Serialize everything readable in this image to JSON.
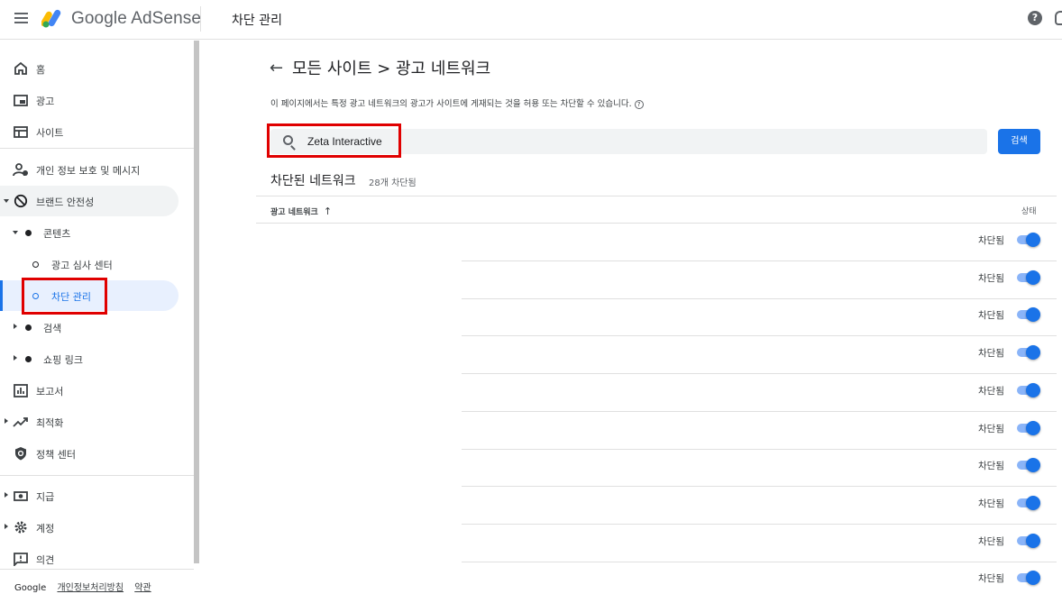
{
  "header": {
    "app_name": "Google AdSense",
    "page_title": "차단 관리",
    "help_symbol": "?"
  },
  "sidebar": {
    "items": [
      {
        "label": "홈",
        "icon": "home-icon"
      },
      {
        "label": "광고",
        "icon": "ads-icon"
      },
      {
        "label": "사이트",
        "icon": "sites-icon"
      },
      {
        "label": "개인 정보 보호 및 메시지",
        "icon": "privacy-icon"
      },
      {
        "label": "브랜드 안전성",
        "icon": "block-icon"
      },
      {
        "label": "콘텐츠"
      },
      {
        "label": "광고 심사 센터"
      },
      {
        "label": "차단 관리"
      },
      {
        "label": "검색"
      },
      {
        "label": "쇼핑 링크"
      },
      {
        "label": "보고서",
        "icon": "reports-icon"
      },
      {
        "label": "최적화",
        "icon": "trending-icon"
      },
      {
        "label": "정책 센터",
        "icon": "policy-icon"
      },
      {
        "label": "지급",
        "icon": "payments-icon"
      },
      {
        "label": "계정",
        "icon": "gear-icon"
      },
      {
        "label": "의견",
        "icon": "feedback-icon"
      }
    ],
    "footer": {
      "brand": "Google",
      "privacy": "개인정보처리방침",
      "terms": "약관"
    }
  },
  "main": {
    "back_symbol": "←",
    "breadcrumb": "모든 사이트 > 광고 네트워크",
    "description": "이 페이지에서는 특정 광고 네트워크의 광고가 사이트에 게재되는 것을 허용 또는 차단할 수 있습니다.",
    "help_symbol": "?",
    "search": {
      "value": "Zeta Interactive",
      "button_label": "검색"
    },
    "section_title": "차단된 네트워크",
    "section_count": "28개 차단됨",
    "columns": {
      "network": "광고 네트워크",
      "sort_symbol": "↑",
      "status": "상태"
    },
    "rows": [
      {
        "status": "차단됨",
        "blocked": true
      },
      {
        "status": "차단됨",
        "blocked": true
      },
      {
        "status": "차단됨",
        "blocked": true
      },
      {
        "status": "차단됨",
        "blocked": true
      },
      {
        "status": "차단됨",
        "blocked": true
      },
      {
        "status": "차단됨",
        "blocked": true
      },
      {
        "status": "차단됨",
        "blocked": true
      },
      {
        "status": "차단됨",
        "blocked": true
      },
      {
        "status": "차단됨",
        "blocked": true
      },
      {
        "status": "차단됨",
        "blocked": true
      }
    ]
  },
  "colors": {
    "accent": "#1a73e8",
    "highlight": "#e00000",
    "toggle_track": "#8ab4f8"
  }
}
